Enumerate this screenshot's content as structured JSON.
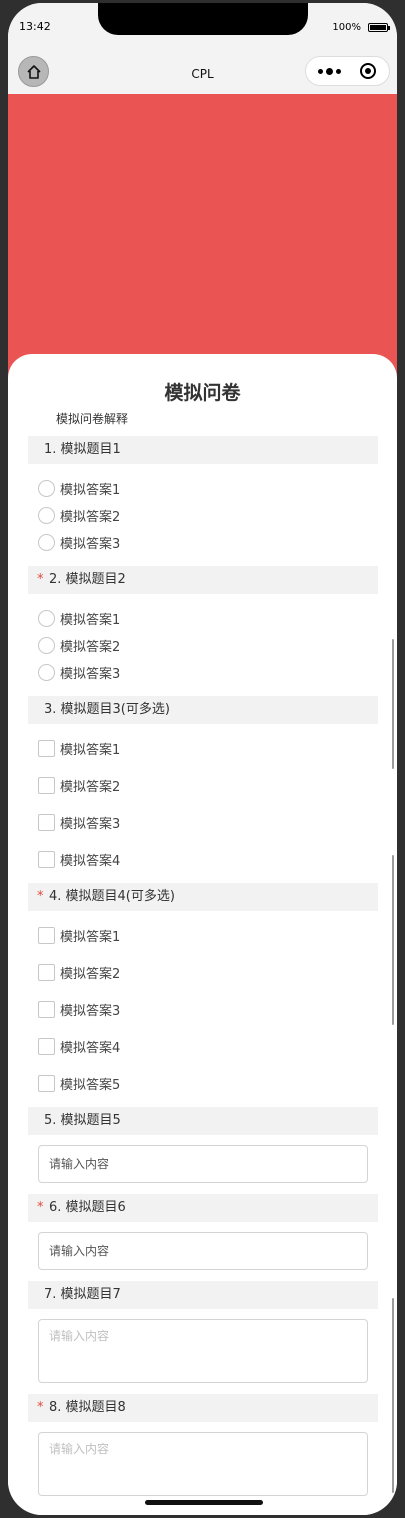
{
  "status_bar": {
    "time": "13:42",
    "battery": "100%"
  },
  "nav": {
    "title": "CPL"
  },
  "survey": {
    "title": "模拟问卷",
    "description": "模拟问卷解释",
    "questions": [
      {
        "label": "1. 模拟题目1",
        "required": false,
        "type": "radio",
        "options": [
          "模拟答案1",
          "模拟答案2",
          "模拟答案3"
        ]
      },
      {
        "label": "2. 模拟题目2",
        "required": true,
        "type": "radio",
        "options": [
          "模拟答案1",
          "模拟答案2",
          "模拟答案3"
        ]
      },
      {
        "label": "3. 模拟题目3(可多选)",
        "required": false,
        "type": "checkbox",
        "options": [
          "模拟答案1",
          "模拟答案2",
          "模拟答案3",
          "模拟答案4"
        ]
      },
      {
        "label": "4. 模拟题目4(可多选)",
        "required": true,
        "type": "checkbox",
        "options": [
          "模拟答案1",
          "模拟答案2",
          "模拟答案3",
          "模拟答案4",
          "模拟答案5"
        ]
      },
      {
        "label": "5. 模拟题目5",
        "required": false,
        "type": "input",
        "placeholder": "请输入内容"
      },
      {
        "label": "6. 模拟题目6",
        "required": true,
        "type": "input",
        "placeholder": "请输入内容"
      },
      {
        "label": "7. 模拟题目7",
        "required": false,
        "type": "textarea",
        "placeholder": "请输入内容"
      },
      {
        "label": "8. 模拟题目8",
        "required": true,
        "type": "textarea",
        "placeholder": "请输入内容"
      }
    ]
  },
  "required_mark": "*",
  "colors": {
    "banner": "#ea5452",
    "required": "#e0493f"
  }
}
